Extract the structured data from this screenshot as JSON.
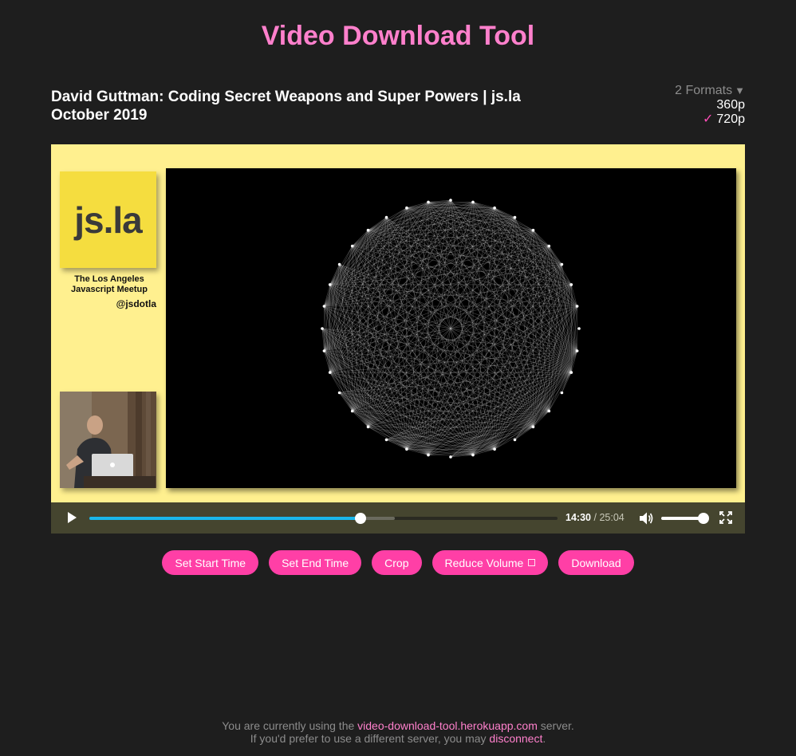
{
  "app": {
    "title": "Video Download Tool"
  },
  "video": {
    "title": "David Guttman: Coding Secret Weapons and Super Powers | js.la October 2019"
  },
  "formats": {
    "toggle_label": "2 Formats",
    "toggle_icon": "caret-down-icon",
    "options": [
      {
        "label": "360p",
        "selected": false
      },
      {
        "label": "720p",
        "selected": true
      }
    ],
    "selected_icon": "checkmark-icon"
  },
  "slide": {
    "logo_text": "js.la",
    "caption_line1": "The Los Angeles",
    "caption_line2": "Javascript Meetup",
    "handle": "@jsdotla"
  },
  "player": {
    "current_time": "14:30",
    "separator": "/",
    "duration": "25:04",
    "progress_fraction": 0.579,
    "buffered_fraction": 0.653,
    "volume_fraction": 1.0,
    "accent_color": "#1ab7ea"
  },
  "actions": {
    "set_start": "Set Start Time",
    "set_end": "Set End Time",
    "crop": "Crop",
    "reduce_volume": "Reduce Volume",
    "download": "Download",
    "button_color": "#ff3fa6"
  },
  "footer": {
    "line1_prefix": "You are currently using the",
    "server_link": "video-download-tool.herokuapp.com",
    "line1_suffix": "server.",
    "line2_prefix": "If you'd prefer to use a different server, you may",
    "disconnect_link": "disconnect",
    "line2_suffix": "."
  },
  "colors": {
    "background": "#1e1e1e",
    "title_pink": "#ff80cc",
    "slide_yellow": "#fff08f"
  }
}
